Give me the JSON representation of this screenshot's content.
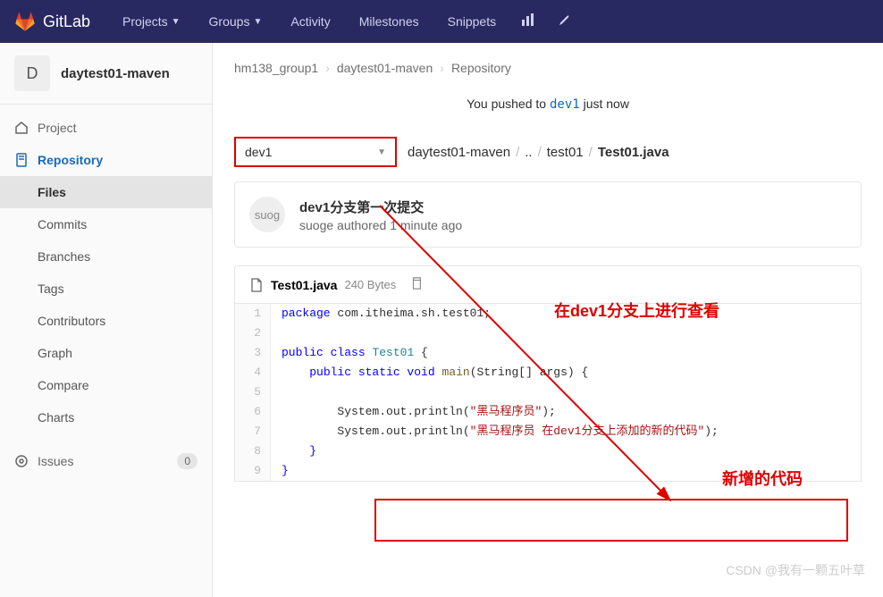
{
  "navbar": {
    "brand": "GitLab",
    "items": [
      "Projects",
      "Groups",
      "Activity",
      "Milestones",
      "Snippets"
    ]
  },
  "sidebar": {
    "project_initial": "D",
    "project_name": "daytest01-maven",
    "top_items": [
      {
        "label": "Project",
        "icon": "home"
      },
      {
        "label": "Repository",
        "icon": "doc",
        "active": true
      }
    ],
    "sub_items": [
      "Files",
      "Commits",
      "Branches",
      "Tags",
      "Contributors",
      "Graph",
      "Compare",
      "Charts"
    ],
    "sub_active": 0,
    "bottom_item": {
      "label": "Issues",
      "badge": "0",
      "icon": "issues"
    }
  },
  "breadcrumb": {
    "parts": [
      "hm138_group1",
      "daytest01-maven",
      "Repository"
    ]
  },
  "push_notice": {
    "prefix": "You pushed to ",
    "branch": "dev1",
    "suffix": " just now"
  },
  "branch_selector": "dev1",
  "file_breadcrumb": [
    "daytest01-maven",
    "..",
    "test01",
    "Test01.java"
  ],
  "commit": {
    "avatar_text": "suog",
    "title": "dev1分支第一次提交",
    "meta": "suoge authored 1 minute ago"
  },
  "file": {
    "name": "Test01.java",
    "size": "240 Bytes"
  },
  "code_lines": [
    {
      "n": 1,
      "html": "<span class='kw'>package</span> com.itheima.sh.test01;"
    },
    {
      "n": 2,
      "html": ""
    },
    {
      "n": 3,
      "html": "<span class='kw'>public class</span> <span class='cls'>Test01</span> {"
    },
    {
      "n": 4,
      "html": "    <span class='kw'>public static void</span> <span class='mth'>main</span>(String[] args) {"
    },
    {
      "n": 5,
      "html": ""
    },
    {
      "n": 6,
      "html": "        System.out.println(<span class='str'>\"黑马程序员\"</span>);"
    },
    {
      "n": 7,
      "html": "        System.out.println(<span class='str'>\"黑马程序员 在dev1分支上添加的新的代码\"</span>);"
    },
    {
      "n": 8,
      "html": "    <span class='kw'>}</span>"
    },
    {
      "n": 9,
      "html": "<span class='kw'>}</span>"
    }
  ],
  "annotations": {
    "view_text": "在dev1分支上进行查看",
    "new_code_text": "新增的代码",
    "watermark": "CSDN @我有一颗五叶草"
  }
}
